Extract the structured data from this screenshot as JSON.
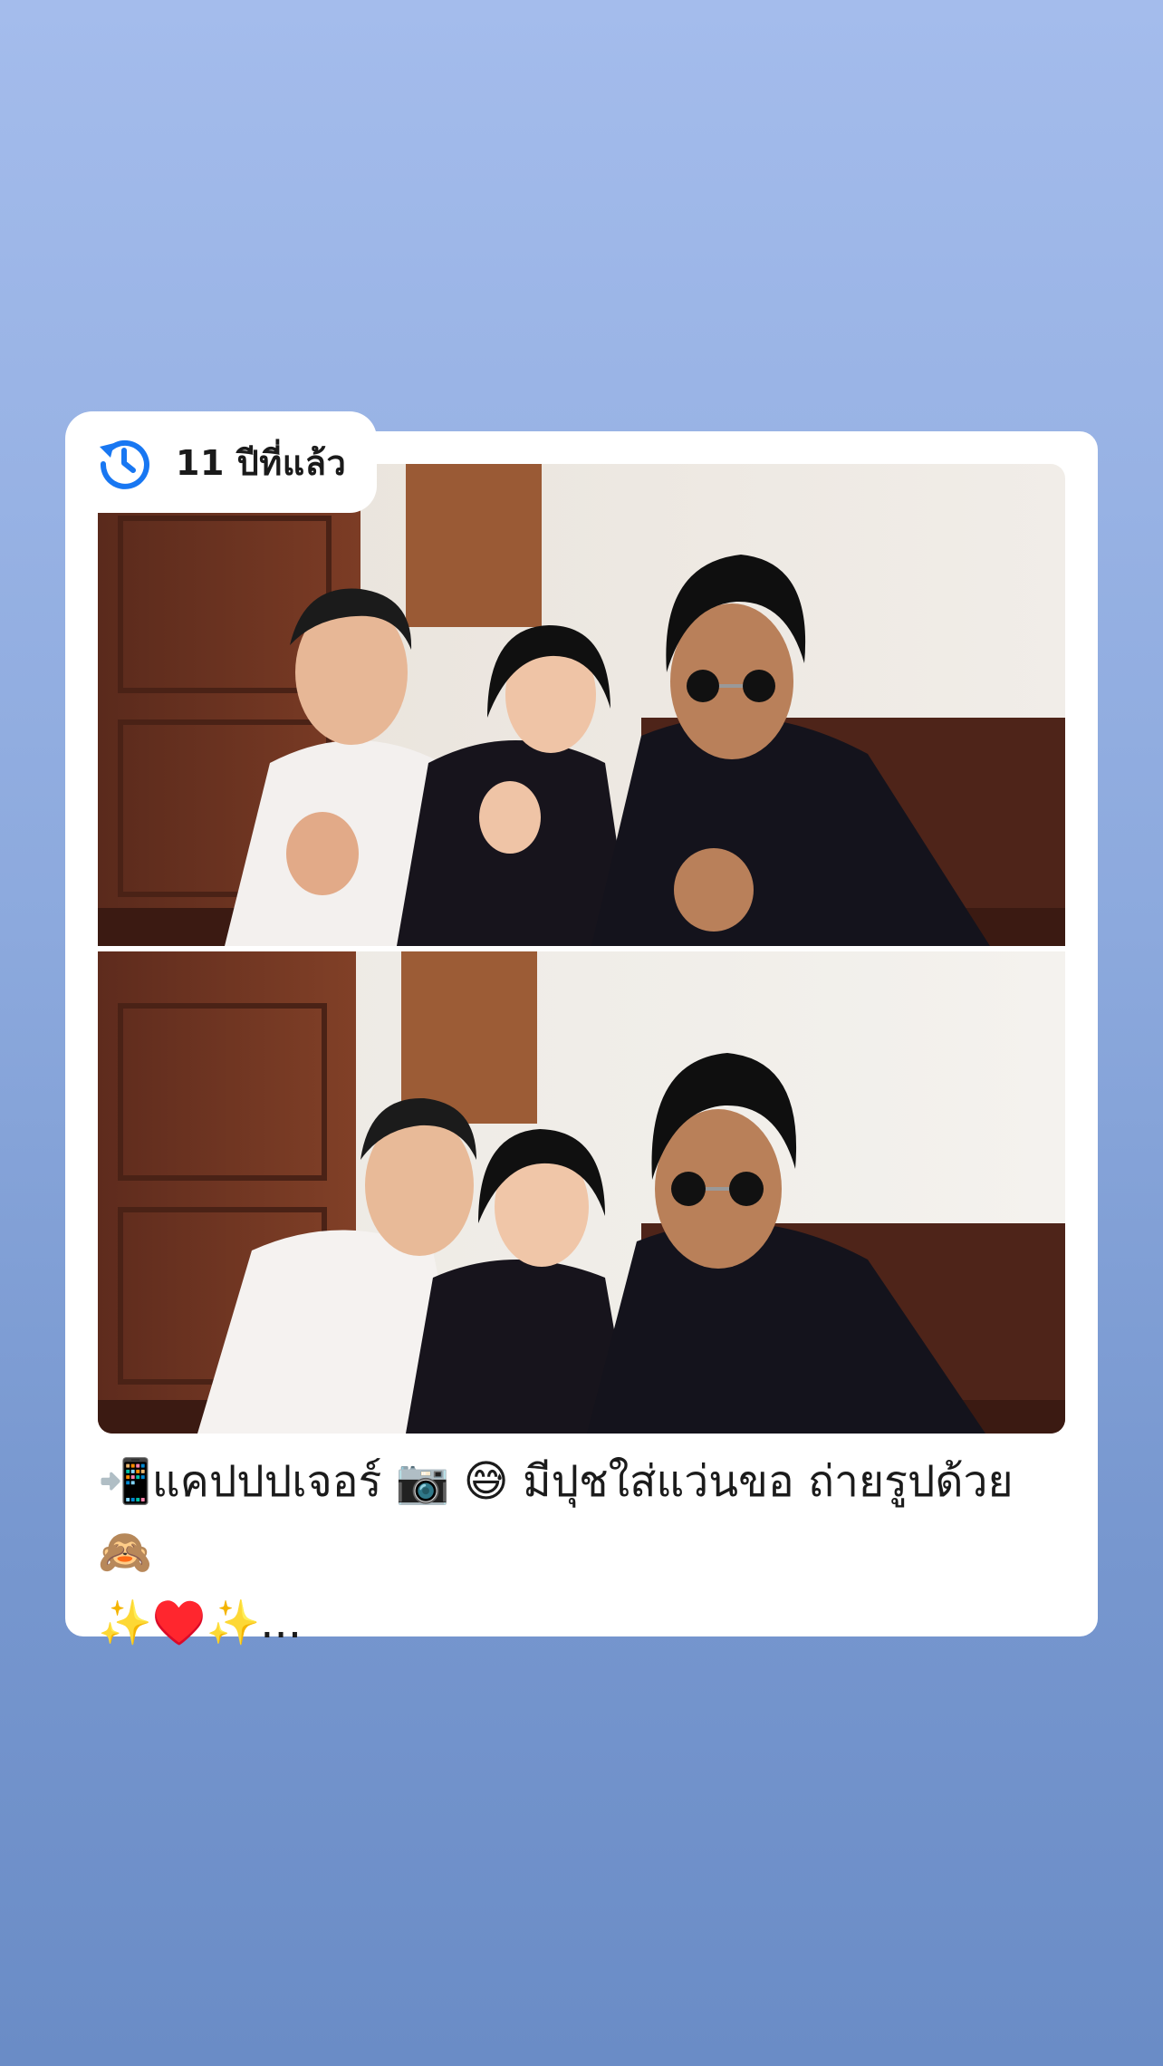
{
  "memory": {
    "badge": {
      "icon": "history-clock-icon",
      "icon_color": "#1877f2",
      "label": "11 ปีที่แล้ว"
    },
    "photos": [
      {
        "name": "group-photo-1"
      },
      {
        "name": "group-photo-2"
      }
    ],
    "caption": "📲แคปปปเจอร์ 📷 😅 มีปุชใส่แว่นขอ ถ่ายรูปด้วย 🙈\n✨♥️✨..."
  },
  "colors": {
    "background_top": "#a4bcec",
    "background_bottom": "#6a8cc6",
    "card": "#ffffff",
    "text": "#1b1b1b"
  }
}
